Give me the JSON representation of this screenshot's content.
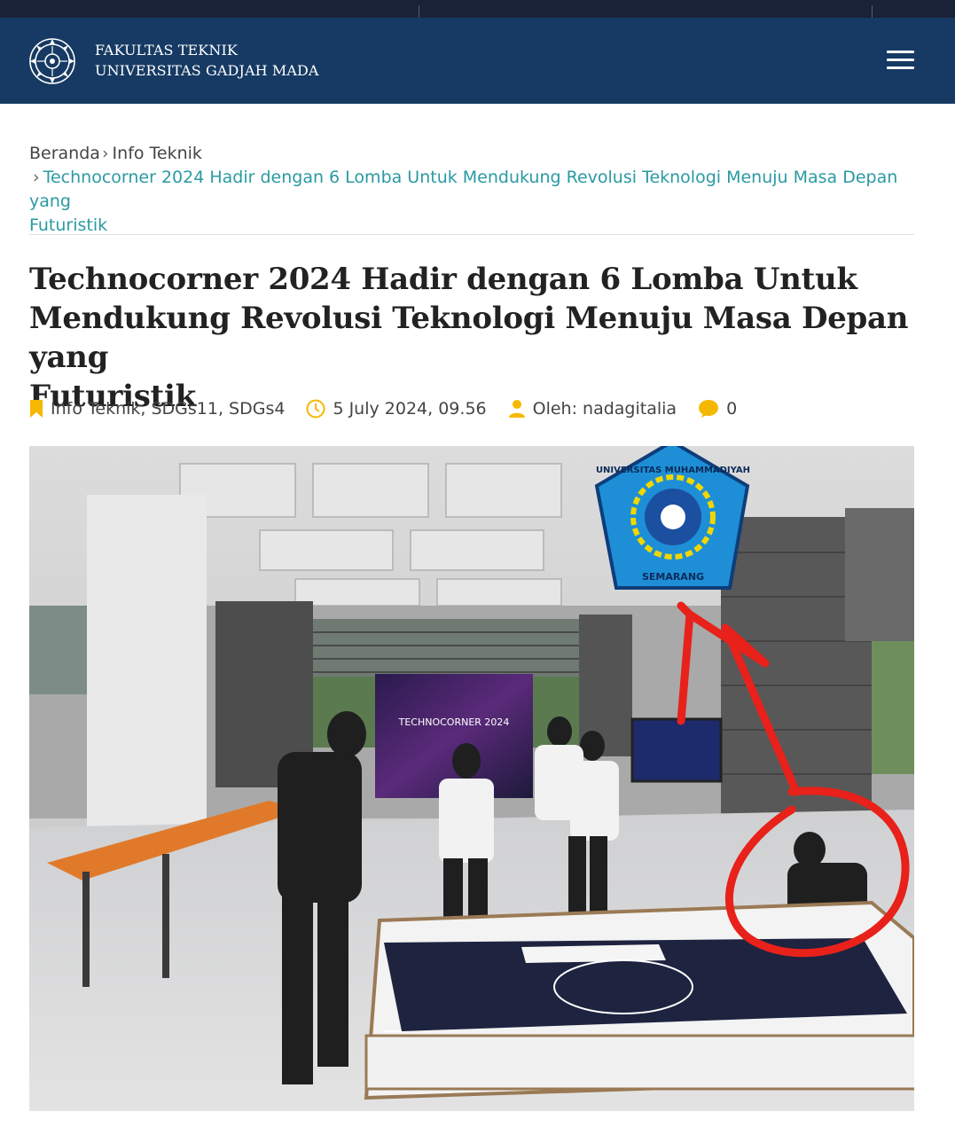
{
  "header": {
    "brand_line1": "FAKULTAS TEKNIK",
    "brand_line2": "UNIVERSITAS GADJAH MADA",
    "menu_icon": "hamburger-icon",
    "background_color": "#163a63"
  },
  "breadcrumb": {
    "home": "Beranda",
    "category": "Info Teknik",
    "current_line1": "Technocorner 2024 Hadir dengan 6 Lomba Untuk Mendukung Revolusi Teknologi Menuju Masa Depan yang",
    "current_line2": "Futuristik",
    "link_color": "#2a9aa3"
  },
  "article": {
    "title_line1": "Technocorner 2024 Hadir dengan 6 Lomba Untuk",
    "title_line2": "Mendukung Revolusi Teknologi Menuju Masa Depan yang",
    "title_line3": "Futuristik",
    "meta": {
      "categories": "Info Teknik, SDGs11, SDGs4",
      "date": "5 July 2024, 09.56",
      "author": "Oleh: nadagitalia",
      "comments": "0",
      "icon_color": "#f5b800"
    }
  },
  "photo": {
    "banner_text": "TECHNOCORNER 2024",
    "badge_top_text": "UNIVERSITAS MUHAMMADIYAH",
    "badge_bottom_text": "SEMARANG",
    "annotation_color": "#e8211b"
  }
}
